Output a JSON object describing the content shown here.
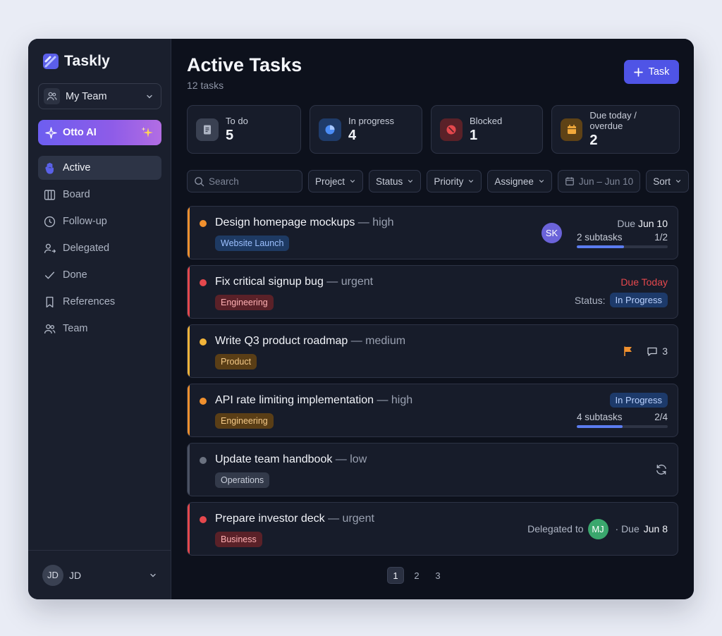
{
  "app": {
    "name": "Taskly"
  },
  "sidebar": {
    "team_select": {
      "label": "My Team"
    },
    "ai_button": {
      "label": "Otto AI"
    },
    "nav": [
      {
        "label": "Active",
        "icon": "hand-icon",
        "active": true
      },
      {
        "label": "Board",
        "icon": "board-icon"
      },
      {
        "label": "Follow-up",
        "icon": "clock-icon"
      },
      {
        "label": "Delegated",
        "icon": "user-share-icon"
      },
      {
        "label": "Done",
        "icon": "check-icon"
      },
      {
        "label": "References",
        "icon": "bookmark-icon"
      },
      {
        "label": "Team",
        "icon": "team-icon"
      }
    ],
    "user": {
      "initials": "JD",
      "name": "JD"
    }
  },
  "header": {
    "title": "Active Tasks",
    "subtitle": "12 tasks",
    "add_button": "Task"
  },
  "stats": [
    {
      "label": "To do",
      "value": "5",
      "color": "#9aa1b1",
      "icon": "document-icon"
    },
    {
      "label": "In progress",
      "value": "4",
      "color": "#4b8cf5",
      "icon": "pie-icon"
    },
    {
      "label": "Blocked",
      "value": "1",
      "color": "#e5484d",
      "icon": "blocked-icon"
    },
    {
      "label": "Due today / overdue",
      "value": "2",
      "color": "#f2a93b",
      "icon": "calendar-icon"
    }
  ],
  "filters": {
    "search_placeholder": "Search",
    "project": "Project",
    "status": "Status",
    "priority": "Priority",
    "assignee": "Assignee",
    "date_range": "Jun – Jun 10",
    "sort": "Sort"
  },
  "tasks": [
    {
      "title": "Design homepage mockups",
      "priority": "— high",
      "tag": "Website Launch",
      "color": "#f0902e",
      "assignee": "SK",
      "due_prefix": "Due",
      "due_date": "Jun 10",
      "subtasks": "2 subtasks",
      "subtask_count": "1/2",
      "progress": 0.5
    },
    {
      "title": "Fix critical signup bug",
      "priority": "— urgent",
      "tag": "Engineering",
      "color": "#e5484d",
      "due": "Due Today",
      "status_label": "Status:",
      "status": "In Progress"
    },
    {
      "title": "Write Q3 product roadmap",
      "priority": "— medium",
      "tag": "Product",
      "color": "#f2b43a",
      "comments": "3"
    },
    {
      "title": "API rate limiting implementation",
      "priority": "— high",
      "tag": "Engineering",
      "color": "#f0902e",
      "status": "In Progress",
      "subtasks": "4 subtasks",
      "subtask_count": "2/4",
      "progress": 0.5
    },
    {
      "title": "Update team handbook",
      "priority": "— low",
      "tag": "Operations",
      "color": "#6b7280"
    },
    {
      "title": "Prepare investor deck",
      "priority": "— urgent",
      "tag": "Business",
      "color": "#e5484d",
      "delegated_label": "Delegated to",
      "delegate": "MJ",
      "due_prefix": "· Due",
      "due_date": "Jun 8"
    }
  ],
  "pagination": {
    "pages": [
      "1",
      "2",
      "3"
    ],
    "current": "1"
  }
}
